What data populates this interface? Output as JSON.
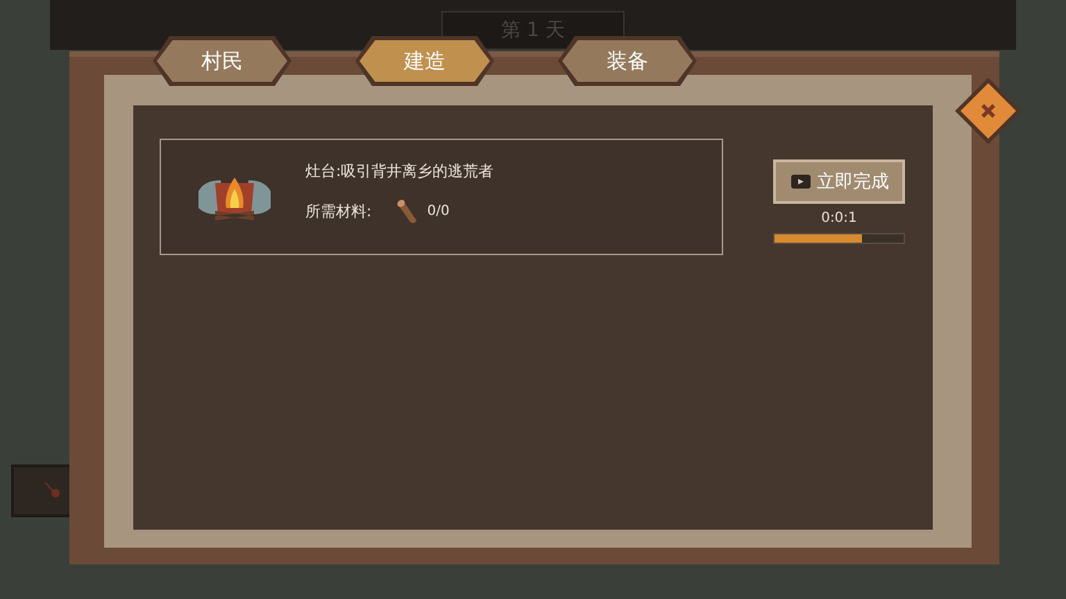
{
  "day_title": "第 1 天",
  "tabs": [
    {
      "label": "村民",
      "selected": false
    },
    {
      "label": "建造",
      "selected": true
    },
    {
      "label": "装备",
      "selected": false
    }
  ],
  "build_items": [
    {
      "title": "灶台:吸引背井离乡的逃荒者",
      "materials_label": "所需材料:",
      "material_count": "0/0",
      "button": "立即完成",
      "timer": "0:0:1",
      "level": 0.68
    }
  ]
}
